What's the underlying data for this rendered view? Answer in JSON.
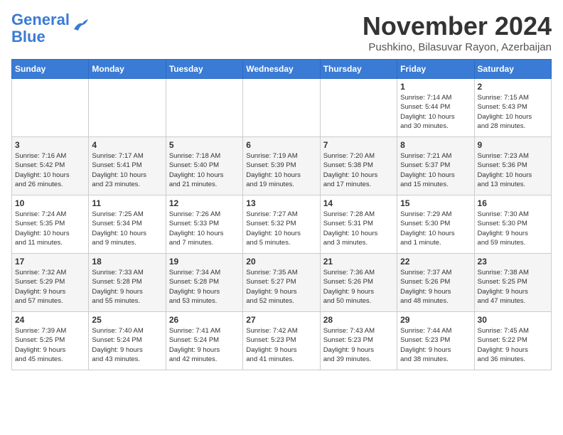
{
  "header": {
    "logo_line1": "General",
    "logo_line2": "Blue",
    "month_title": "November 2024",
    "location": "Pushkino, Bilasuvar Rayon, Azerbaijan"
  },
  "days_of_week": [
    "Sunday",
    "Monday",
    "Tuesday",
    "Wednesday",
    "Thursday",
    "Friday",
    "Saturday"
  ],
  "weeks": [
    [
      {
        "day": "",
        "info": ""
      },
      {
        "day": "",
        "info": ""
      },
      {
        "day": "",
        "info": ""
      },
      {
        "day": "",
        "info": ""
      },
      {
        "day": "",
        "info": ""
      },
      {
        "day": "1",
        "info": "Sunrise: 7:14 AM\nSunset: 5:44 PM\nDaylight: 10 hours\nand 30 minutes."
      },
      {
        "day": "2",
        "info": "Sunrise: 7:15 AM\nSunset: 5:43 PM\nDaylight: 10 hours\nand 28 minutes."
      }
    ],
    [
      {
        "day": "3",
        "info": "Sunrise: 7:16 AM\nSunset: 5:42 PM\nDaylight: 10 hours\nand 26 minutes."
      },
      {
        "day": "4",
        "info": "Sunrise: 7:17 AM\nSunset: 5:41 PM\nDaylight: 10 hours\nand 23 minutes."
      },
      {
        "day": "5",
        "info": "Sunrise: 7:18 AM\nSunset: 5:40 PM\nDaylight: 10 hours\nand 21 minutes."
      },
      {
        "day": "6",
        "info": "Sunrise: 7:19 AM\nSunset: 5:39 PM\nDaylight: 10 hours\nand 19 minutes."
      },
      {
        "day": "7",
        "info": "Sunrise: 7:20 AM\nSunset: 5:38 PM\nDaylight: 10 hours\nand 17 minutes."
      },
      {
        "day": "8",
        "info": "Sunrise: 7:21 AM\nSunset: 5:37 PM\nDaylight: 10 hours\nand 15 minutes."
      },
      {
        "day": "9",
        "info": "Sunrise: 7:23 AM\nSunset: 5:36 PM\nDaylight: 10 hours\nand 13 minutes."
      }
    ],
    [
      {
        "day": "10",
        "info": "Sunrise: 7:24 AM\nSunset: 5:35 PM\nDaylight: 10 hours\nand 11 minutes."
      },
      {
        "day": "11",
        "info": "Sunrise: 7:25 AM\nSunset: 5:34 PM\nDaylight: 10 hours\nand 9 minutes."
      },
      {
        "day": "12",
        "info": "Sunrise: 7:26 AM\nSunset: 5:33 PM\nDaylight: 10 hours\nand 7 minutes."
      },
      {
        "day": "13",
        "info": "Sunrise: 7:27 AM\nSunset: 5:32 PM\nDaylight: 10 hours\nand 5 minutes."
      },
      {
        "day": "14",
        "info": "Sunrise: 7:28 AM\nSunset: 5:31 PM\nDaylight: 10 hours\nand 3 minutes."
      },
      {
        "day": "15",
        "info": "Sunrise: 7:29 AM\nSunset: 5:30 PM\nDaylight: 10 hours\nand 1 minute."
      },
      {
        "day": "16",
        "info": "Sunrise: 7:30 AM\nSunset: 5:30 PM\nDaylight: 9 hours\nand 59 minutes."
      }
    ],
    [
      {
        "day": "17",
        "info": "Sunrise: 7:32 AM\nSunset: 5:29 PM\nDaylight: 9 hours\nand 57 minutes."
      },
      {
        "day": "18",
        "info": "Sunrise: 7:33 AM\nSunset: 5:28 PM\nDaylight: 9 hours\nand 55 minutes."
      },
      {
        "day": "19",
        "info": "Sunrise: 7:34 AM\nSunset: 5:28 PM\nDaylight: 9 hours\nand 53 minutes."
      },
      {
        "day": "20",
        "info": "Sunrise: 7:35 AM\nSunset: 5:27 PM\nDaylight: 9 hours\nand 52 minutes."
      },
      {
        "day": "21",
        "info": "Sunrise: 7:36 AM\nSunset: 5:26 PM\nDaylight: 9 hours\nand 50 minutes."
      },
      {
        "day": "22",
        "info": "Sunrise: 7:37 AM\nSunset: 5:26 PM\nDaylight: 9 hours\nand 48 minutes."
      },
      {
        "day": "23",
        "info": "Sunrise: 7:38 AM\nSunset: 5:25 PM\nDaylight: 9 hours\nand 47 minutes."
      }
    ],
    [
      {
        "day": "24",
        "info": "Sunrise: 7:39 AM\nSunset: 5:25 PM\nDaylight: 9 hours\nand 45 minutes."
      },
      {
        "day": "25",
        "info": "Sunrise: 7:40 AM\nSunset: 5:24 PM\nDaylight: 9 hours\nand 43 minutes."
      },
      {
        "day": "26",
        "info": "Sunrise: 7:41 AM\nSunset: 5:24 PM\nDaylight: 9 hours\nand 42 minutes."
      },
      {
        "day": "27",
        "info": "Sunrise: 7:42 AM\nSunset: 5:23 PM\nDaylight: 9 hours\nand 41 minutes."
      },
      {
        "day": "28",
        "info": "Sunrise: 7:43 AM\nSunset: 5:23 PM\nDaylight: 9 hours\nand 39 minutes."
      },
      {
        "day": "29",
        "info": "Sunrise: 7:44 AM\nSunset: 5:23 PM\nDaylight: 9 hours\nand 38 minutes."
      },
      {
        "day": "30",
        "info": "Sunrise: 7:45 AM\nSunset: 5:22 PM\nDaylight: 9 hours\nand 36 minutes."
      }
    ]
  ]
}
